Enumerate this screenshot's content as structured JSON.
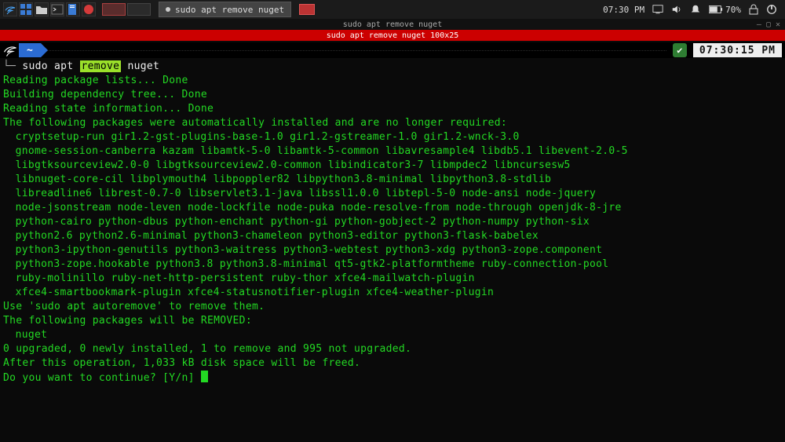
{
  "taskbar": {
    "task_title": "sudo apt remove nuget",
    "time": "07:30 PM",
    "battery": "70%"
  },
  "window": {
    "title_dark": "sudo apt remove nuget",
    "title_red": "sudo apt remove nuget 100x25"
  },
  "prompt": {
    "home": "~",
    "clock": "07:30:15 PM",
    "cmd_prefix": "sudo apt ",
    "cmd_hl": "remove",
    "cmd_suffix": " nuget"
  },
  "output": {
    "reading_lists": "Reading package lists... Done",
    "building_tree": "Building dependency tree... Done",
    "reading_state": "Reading state information... Done",
    "auto_header": "The following packages were automatically installed and are no longer required:",
    "auto_packages": [
      "cryptsetup-run gir1.2-gst-plugins-base-1.0 gir1.2-gstreamer-1.0 gir1.2-wnck-3.0",
      "gnome-session-canberra kazam libamtk-5-0 libamtk-5-common libavresample4 libdb5.1 libevent-2.0-5",
      "libgtksourceview2.0-0 libgtksourceview2.0-common libindicator3-7 libmpdec2 libncursesw5",
      "libnuget-core-cil libplymouth4 libpoppler82 libpython3.8-minimal libpython3.8-stdlib",
      "libreadline6 librest-0.7-0 libservlet3.1-java libssl1.0.0 libtepl-5-0 node-ansi node-jquery",
      "node-jsonstream node-leven node-lockfile node-puka node-resolve-from node-through openjdk-8-jre",
      "python-cairo python-dbus python-enchant python-gi python-gobject-2 python-numpy python-six",
      "python2.6 python2.6-minimal python3-chameleon python3-editor python3-flask-babelex",
      "python3-ipython-genutils python3-waitress python3-webtest python3-xdg python3-zope.component",
      "python3-zope.hookable python3.8 python3.8-minimal qt5-gtk2-platformtheme ruby-connection-pool",
      "ruby-molinillo ruby-net-http-persistent ruby-thor xfce4-mailwatch-plugin",
      "xfce4-smartbookmark-plugin xfce4-statusnotifier-plugin xfce4-weather-plugin"
    ],
    "autoremove_hint": "Use 'sudo apt autoremove' to remove them.",
    "remove_header": "The following packages will be REMOVED:",
    "remove_packages": "nuget",
    "summary": "0 upgraded, 0 newly installed, 1 to remove and 995 not upgraded.",
    "disk": "After this operation, 1,033 kB disk space will be freed.",
    "confirm": "Do you want to continue? [Y/n] "
  }
}
